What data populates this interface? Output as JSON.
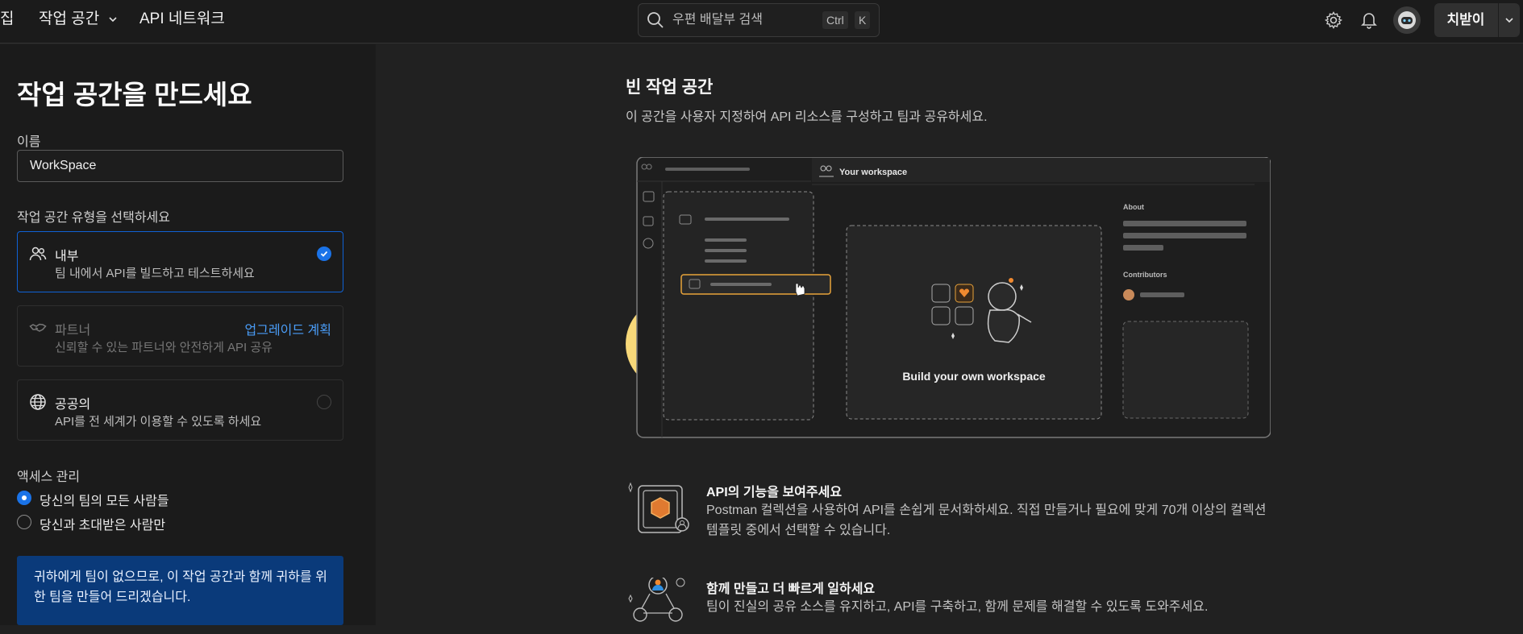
{
  "topbar": {
    "nav": [
      {
        "label": "집"
      },
      {
        "label": "작업 공간"
      },
      {
        "label": "API 네트워크"
      }
    ],
    "search": {
      "placeholder": "우편 배달부 검색",
      "key1": "Ctrl",
      "key2": "K"
    },
    "user_button": {
      "label": "치받이"
    }
  },
  "left": {
    "title": "작업 공간을 만드세요",
    "name_label": "이름",
    "name_value": "WorkSpace",
    "type_label": "작업 공간 유형을 선택하세요",
    "types": [
      {
        "title": "내부",
        "desc": "팀 내에서 API를 빌드하고 테스트하세요"
      },
      {
        "title": "파트너",
        "desc": "신뢰할 수 있는 파트너와 안전하게 API 공유",
        "action": "업그레이드 계획"
      },
      {
        "title": "공공의",
        "desc": "API를 전 세계가 이용할 수 있도록 하세요"
      }
    ],
    "access_label": "액세스 관리",
    "access_options": [
      {
        "label": "당신의 팀의 모든 사람들"
      },
      {
        "label": "당신과 초대받은 사람만"
      }
    ],
    "info_text": "귀하에게 팀이 없으므로, 이 작업 공간과 함께 귀하를 위한 팀을 만들어 드리겠습니다."
  },
  "main": {
    "title": "빈 작업 공간",
    "subtitle": "이 공간을 사용자 지정하여 API 리소스를 구성하고 팀과 공유하세요.",
    "illustration": {
      "workspace_label": "Your workspace",
      "center_caption": "Build your own workspace",
      "about_label": "About",
      "contributors_label": "Contributors"
    },
    "features": [
      {
        "title": "API의 기능을 보여주세요",
        "desc": "Postman 컬렉션을 사용하여 API를 손쉽게 문서화하세요. 직접 만들거나 필요에 맞게 70개 이상의 컬렉션 템플릿 중에서 선택할 수 있습니다."
      },
      {
        "title": "함께 만들고 더 빠르게 일하세요",
        "desc": "팀이 진실의 공유 소스를 유지하고, API를 구축하고, 함께 문제를 해결할 수 있도록 도와주세요."
      }
    ]
  },
  "colors": {
    "accent": "#1a73e8",
    "info_bg": "#0a3a7a",
    "link": "#4a9df8",
    "illustration_orange": "#e8a33a"
  }
}
